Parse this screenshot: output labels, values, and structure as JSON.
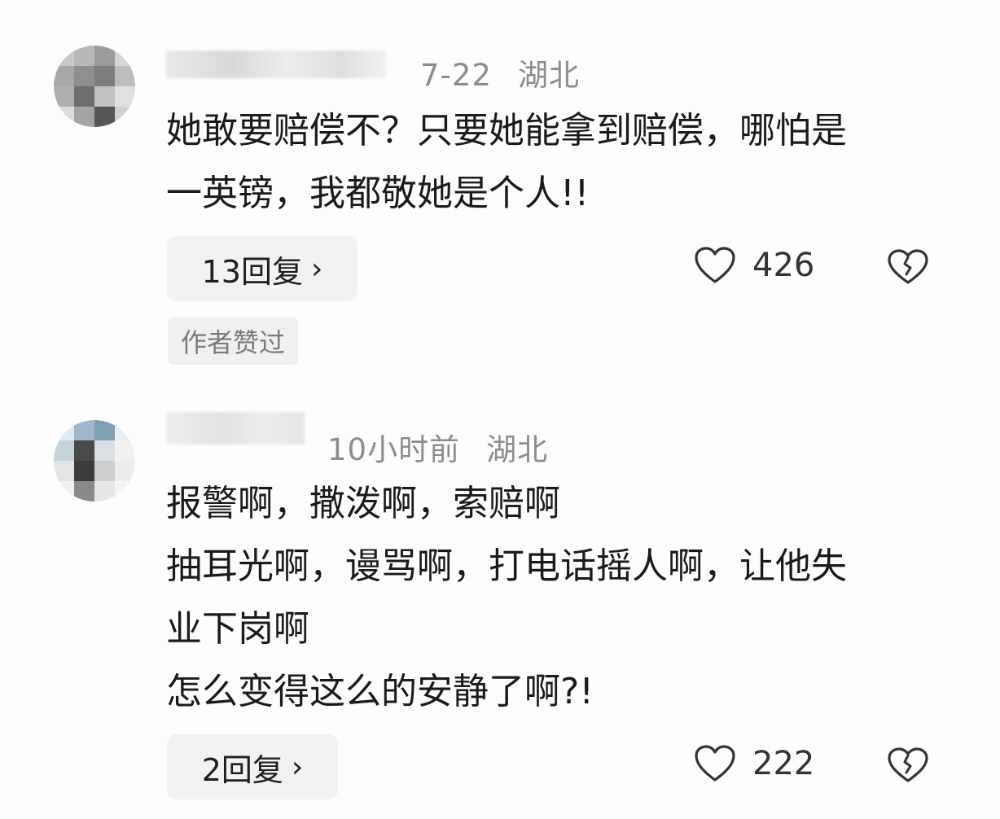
{
  "comments": [
    {
      "date": "7-22",
      "location": "湖北",
      "lines": [
        "她敢要赔偿不？只要她能拿到赔偿，哪怕是",
        "一英镑，我都敬她是个人!!"
      ],
      "reply_label": "13回复",
      "reply_chevron": "›",
      "likes": "426",
      "author_liked_label": "作者赞过"
    },
    {
      "date": "10小时前",
      "location": "湖北",
      "lines": [
        "报警啊，撒泼啊，索赔啊",
        "抽耳光啊，谩骂啊，打电话摇人啊，让他失",
        "业下岗啊",
        "怎么变得这么的安静了啊?!"
      ],
      "reply_label": "2回复",
      "reply_chevron": "›",
      "likes": "222"
    }
  ],
  "icons": {
    "like": "heart-outline-icon",
    "dislike": "broken-heart-icon"
  },
  "colors": {
    "meta_text": "#8c8c8c",
    "body_text": "#1a1a1a",
    "button_bg": "#f2f2f2",
    "icon_stroke": "#333333"
  }
}
